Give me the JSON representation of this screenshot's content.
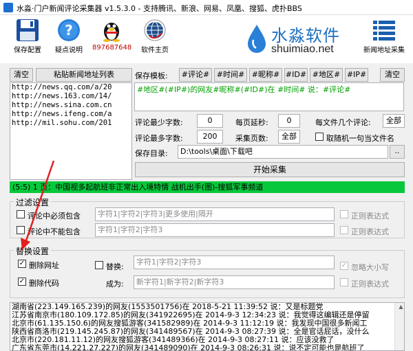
{
  "window": {
    "title": "水淼·门户新闻评论采集器 v1.5.3.0 - 支持腾讯、新浪、网易、凤凰、搜狐、虎扑BBS"
  },
  "toolbar": {
    "save_config": "保存配置",
    "help": "疑点说明",
    "qq": "897687648",
    "homepage": "软件主页",
    "brand_cn": "水淼软件",
    "brand_url": "shuimiao.net",
    "news_list": "新闻地址采集"
  },
  "left": {
    "clear": "清空",
    "paste": "粘贴新闻地址列表",
    "urls": [
      "http://news.qq.com/a/20",
      "http://news.163.com/14/",
      "http://news.sina.com.cn",
      "http://news.ifeng.com/a",
      "http://mil.sohu.com/201"
    ]
  },
  "template": {
    "label": "保存模板:",
    "tags": [
      "#评论#",
      "#时间#",
      "#昵称#",
      "#ID#",
      "#地区#",
      "#IP#"
    ],
    "clear": "清空",
    "value": "#地区#(#IP#)的网友#昵称#(#ID#)在 #时间# 说：#评论#"
  },
  "settings": {
    "min_chars_label": "评论最少字数:",
    "min_chars": "0",
    "max_chars_label": "评论最多字数:",
    "max_chars": "200",
    "delay_label": "每页延秒:",
    "delay": "0",
    "pages_label": "采集页数:",
    "pages": "全部",
    "per_file_label": "每文件几个评论:",
    "per_file": "全部",
    "random_name_label": "取随机一句当文件名",
    "save_dir_label": "保存目录:",
    "save_dir": "D:\\tools\\桌面\\下载吧",
    "browse": "..",
    "start": "开始采集"
  },
  "status": {
    "text": "(5:5) 1 页：中国视多起航班非正常出入境特情 战机出手(图)-搜狐军事频道"
  },
  "filter": {
    "title": "过滤设置",
    "must_contain_label": "评论中必须包含",
    "must_contain_placeholder": "字符1|字符2|字符3|更多使用|隔开",
    "not_contain_label": "评论中不能包含",
    "not_contain_placeholder": "字符1|字符2|字符3",
    "regex1": "正则表达式",
    "regex2": "正则表达式"
  },
  "replace": {
    "title": "替换设置",
    "remove_url": "删除网址",
    "remove_code": "删除代码",
    "replace_label": "替换:",
    "replace_placeholder": "字符1|字符2|字符3",
    "ignore_case": "忽略大小写",
    "become_label": "成为:",
    "become_placeholder": "新字符1|新字符2|新字符3",
    "regex": "正则表达式"
  },
  "log": {
    "lines": [
      "湖南省(223.149.165.239)的网友(1553501756)在  2018-5-21 11:39:52 说：又是标题党",
      "江苏省南京市(180.109.172.85)的网友(341922695)在  2014-9-3 12:34:23 说：我觉得这编辑还是停留",
      "北京市(61.135.150.6)的网友搜狐游客(341582989)在  2014-9-3 11:12:19 说：我发现中国很多新闻工",
      "陕西省商洛市(219.145.245.87)的网友(341489567)在  2014-9-3 08:27:39 说：全是官话屁话，没什么",
      "北京市(220.181.11.12)的网友搜狐游客(341489366)在  2014-9-3 08:27:11 说：应该没救了",
      "广东省东莞市(14.221.27.227)的网友(341489090)在  2014-9-3 08:26:31 说：说不定可能也是航班了"
    ]
  },
  "colors": {
    "accent": "#07c83c",
    "template_text": "#00a000",
    "arrow": "#e02020"
  }
}
